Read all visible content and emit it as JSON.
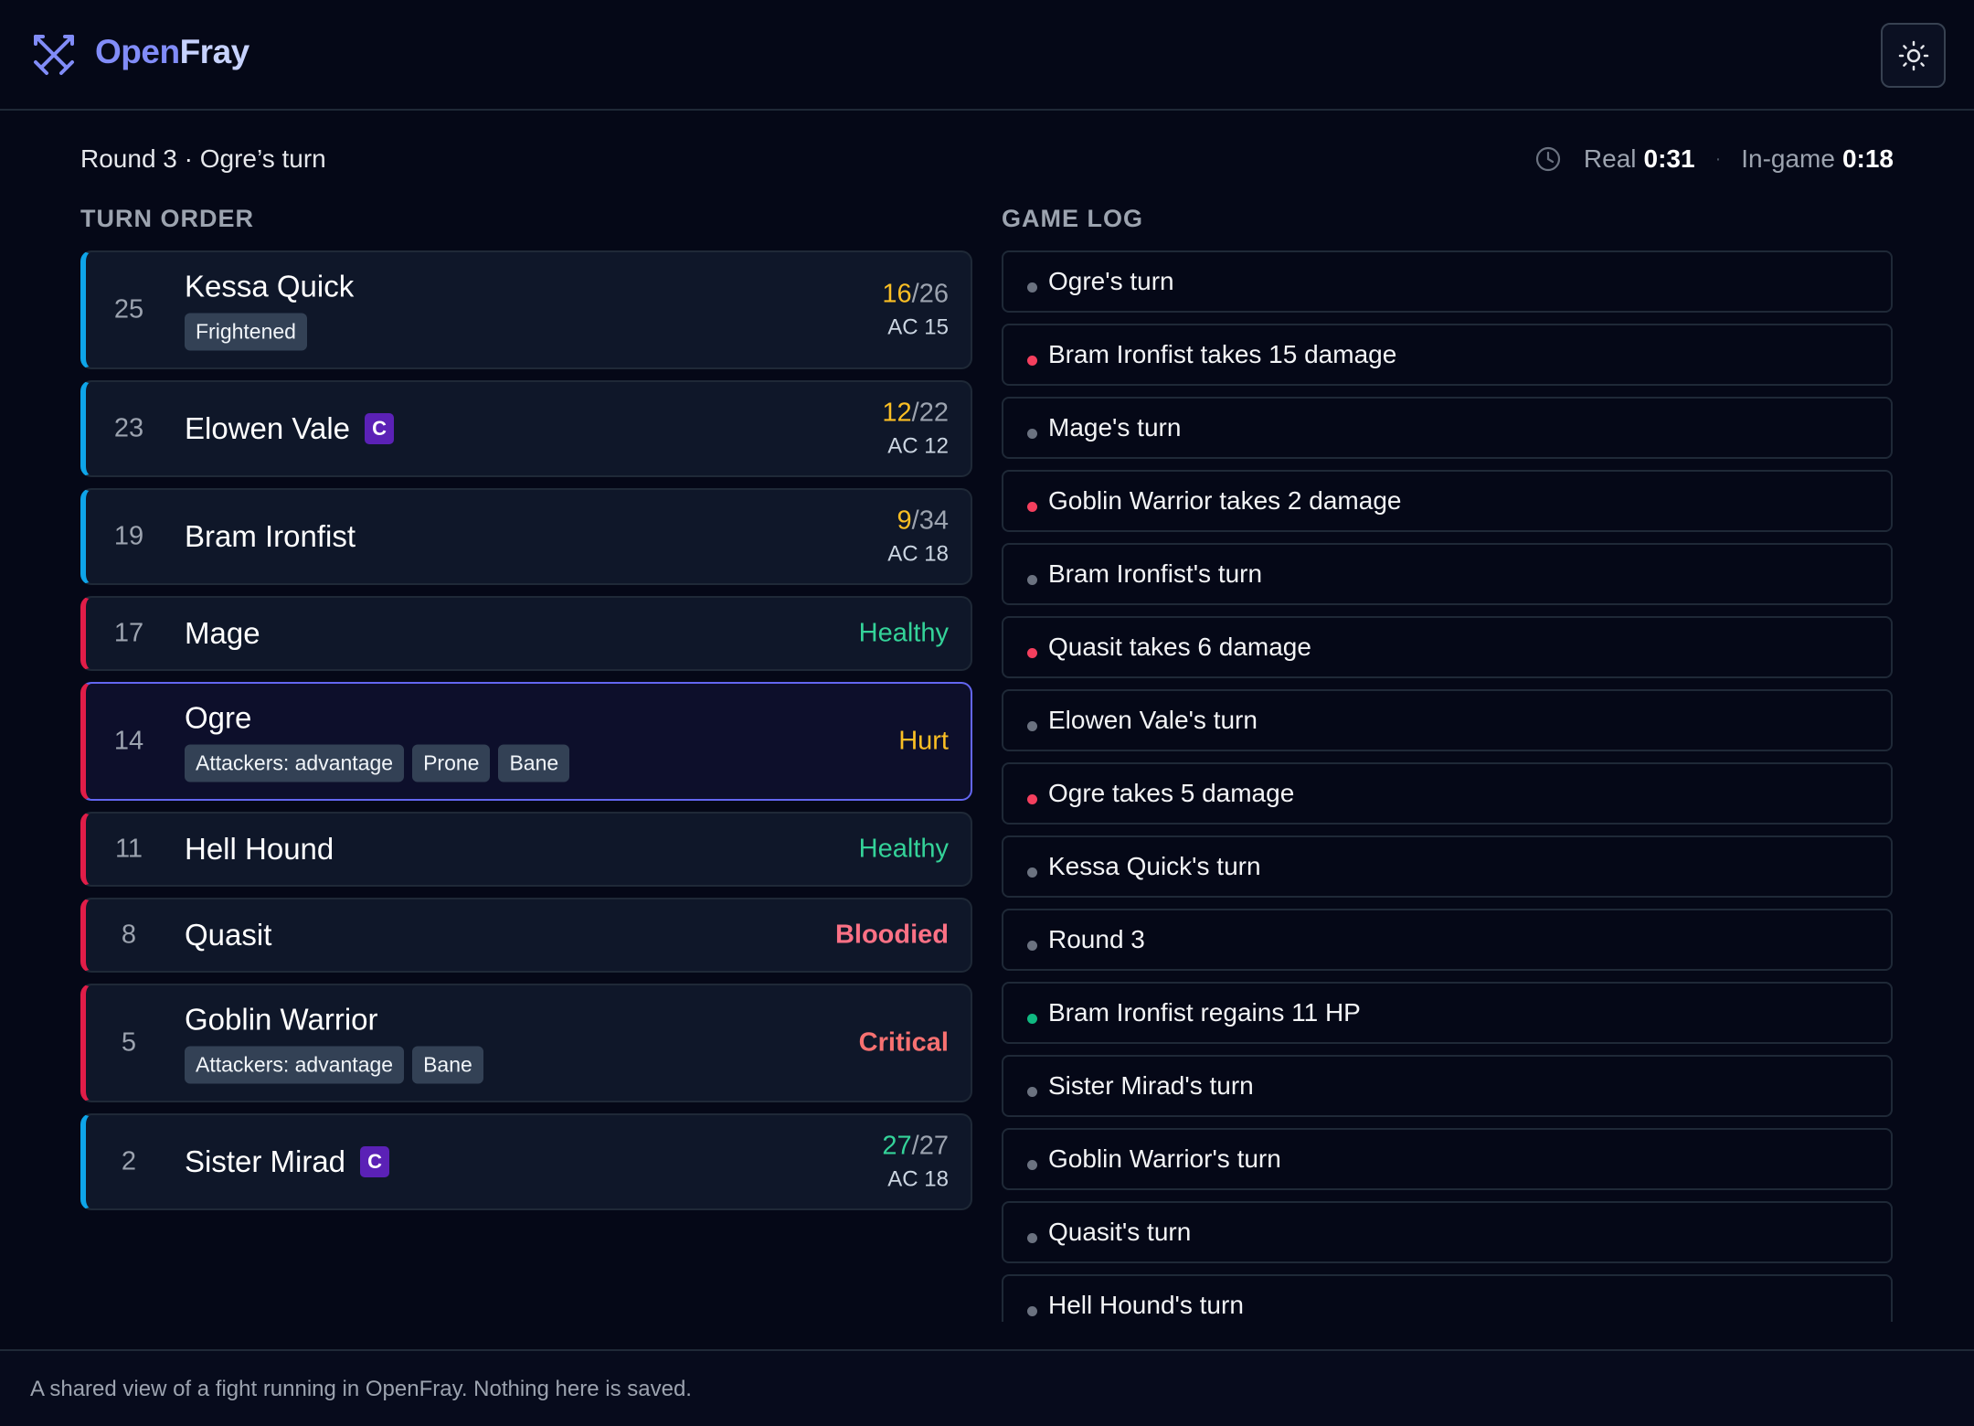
{
  "app": {
    "brand_open": "Open",
    "brand_fray": "Fray",
    "logo_icon": "crossed-swords-icon",
    "theme_icon": "sun-icon"
  },
  "header": {
    "round_text": "Round 3 · Ogre’s turn",
    "real_label": "Real",
    "real_time": "0:31",
    "separator": "·",
    "ingame_label": "In-game",
    "ingame_time": "0:18"
  },
  "turn_order": {
    "title": "TURN ORDER",
    "items": [
      {
        "init": "25",
        "name": "Kessa Quick",
        "badge": "",
        "tags": [
          "Frightened"
        ],
        "hp_cur": "16",
        "hp_max": "/26",
        "ac": "AC 15",
        "status": ""
      },
      {
        "init": "23",
        "name": "Elowen Vale",
        "badge": "C",
        "tags": [],
        "hp_cur": "12",
        "hp_max": "/22",
        "ac": "AC 12",
        "status": ""
      },
      {
        "init": "19",
        "name": "Bram Ironfist",
        "badge": "",
        "tags": [],
        "hp_cur": "9",
        "hp_max": "/34",
        "ac": "AC 18",
        "status": ""
      },
      {
        "init": "17",
        "name": "Mage",
        "badge": "",
        "tags": [],
        "status": "Healthy"
      },
      {
        "init": "14",
        "name": "Ogre",
        "badge": "",
        "tags": [
          "Attackers: advantage",
          "Prone",
          "Bane"
        ],
        "status": "Hurt"
      },
      {
        "init": "11",
        "name": "Hell Hound",
        "badge": "",
        "tags": [],
        "status": "Healthy"
      },
      {
        "init": "8",
        "name": "Quasit",
        "badge": "",
        "tags": [],
        "status": "Bloodied"
      },
      {
        "init": "5",
        "name": "Goblin Warrior",
        "badge": "",
        "tags": [
          "Attackers: advantage",
          "Bane"
        ],
        "status": "Critical"
      },
      {
        "init": "2",
        "name": "Sister Mirad",
        "badge": "C",
        "tags": [],
        "hp_cur": "27",
        "hp_max": "/27",
        "ac": "AC 18",
        "status": ""
      }
    ]
  },
  "game_log": {
    "title": "GAME LOG",
    "items": [
      {
        "text": "Ogre's turn",
        "kind": "turn"
      },
      {
        "text": "Bram Ironfist takes 15 damage",
        "kind": "damage"
      },
      {
        "text": "Mage's turn",
        "kind": "turn"
      },
      {
        "text": "Goblin Warrior takes 2 damage",
        "kind": "damage"
      },
      {
        "text": "Bram Ironfist's turn",
        "kind": "turn"
      },
      {
        "text": "Quasit takes 6 damage",
        "kind": "damage"
      },
      {
        "text": "Elowen Vale's turn",
        "kind": "turn"
      },
      {
        "text": "Ogre takes 5 damage",
        "kind": "damage"
      },
      {
        "text": "Kessa Quick's turn",
        "kind": "turn"
      },
      {
        "text": "Round 3",
        "kind": "turn"
      },
      {
        "text": "Bram Ironfist regains 11 HP",
        "kind": "heal"
      },
      {
        "text": "Sister Mirad's turn",
        "kind": "turn"
      },
      {
        "text": "Goblin Warrior's turn",
        "kind": "turn"
      },
      {
        "text": "Quasit's turn",
        "kind": "turn"
      },
      {
        "text": "Hell Hound's turn",
        "kind": "turn"
      }
    ]
  },
  "colors": {
    "accent": "#6366f1",
    "player": "#0ea5e9",
    "monster": "#e11d48",
    "healthy": "#34d399",
    "hurt": "#fbbf24",
    "bloodied": "#fb7185",
    "critical": "#f87171"
  },
  "footer": {
    "text": "A shared view of a fight running in OpenFray. Nothing here is saved."
  }
}
